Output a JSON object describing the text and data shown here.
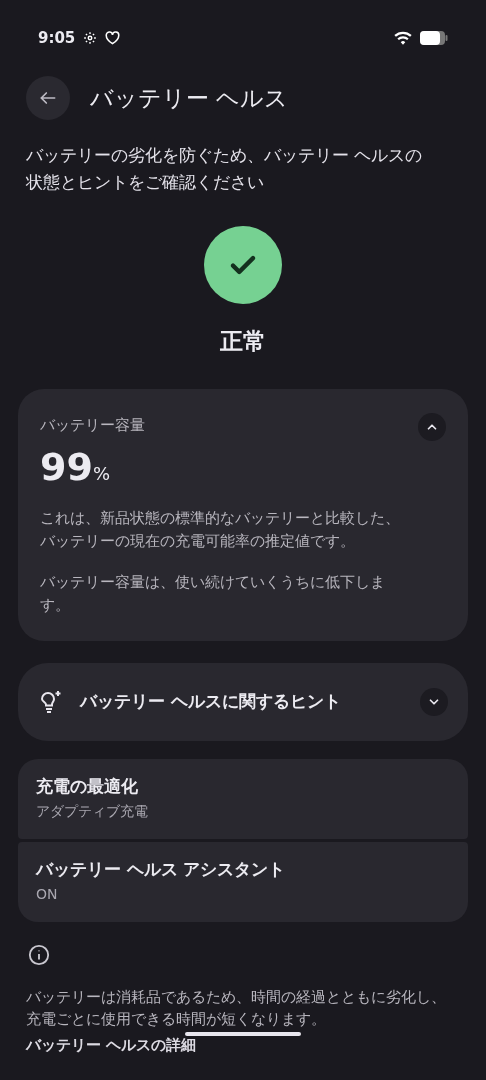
{
  "status_bar": {
    "time": "9:05"
  },
  "header": {
    "title": "バッテリー ヘルス"
  },
  "intro": "バッテリーの劣化を防ぐため、バッテリー ヘルスの状態とヒントをご確認ください",
  "status": {
    "label": "正常",
    "kind": "ok"
  },
  "capacity_card": {
    "title": "バッテリー容量",
    "value": "99",
    "unit": "%",
    "expanded": true,
    "paragraphs": [
      "これは、新品状態の標準的なバッテリーと比較した、バッテリーの現在の充電可能率の推定値です。",
      "バッテリー容量は、使い続けていくうちに低下します。"
    ]
  },
  "tips_card": {
    "title": "バッテリー ヘルスに関するヒント",
    "expanded": false
  },
  "settings": [
    {
      "title": "充電の最適化",
      "subtitle": "アダプティブ充電"
    },
    {
      "title": "バッテリー ヘルス アシスタント",
      "subtitle": "ON"
    }
  ],
  "footer": {
    "note": "バッテリーは消耗品であるため、時間の経過とともに劣化し、充電ごとに使用できる時間が短くなります。",
    "link": "バッテリー ヘルスの詳細"
  }
}
